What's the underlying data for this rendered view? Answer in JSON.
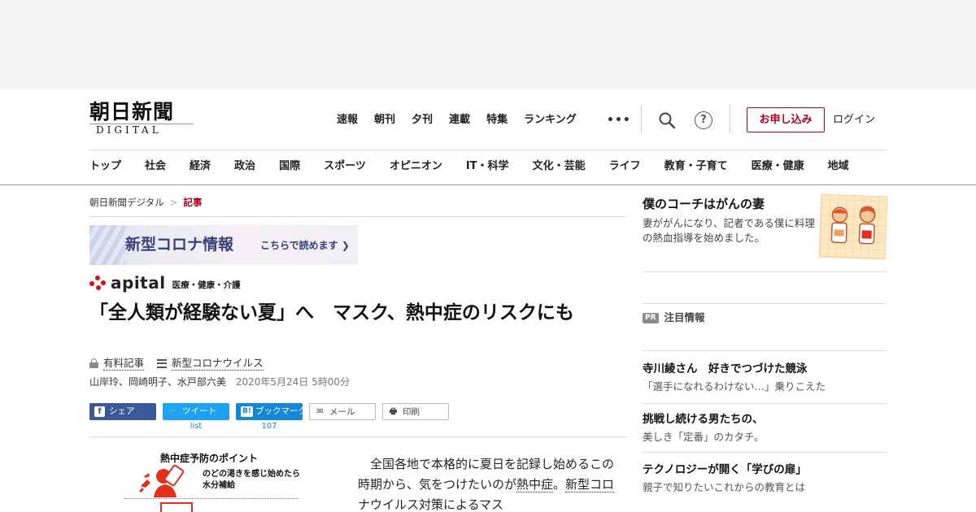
{
  "site": {
    "logo_main": "朝日新聞",
    "logo_sub": "DIGITAL"
  },
  "topnav": [
    "速報",
    "朝刊",
    "夕刊",
    "連載",
    "特集",
    "ランキング"
  ],
  "more_icon": "more-dots-icon",
  "header": {
    "help_glyph": "?",
    "apply_label": "お申し込み",
    "login_label": "ログイン"
  },
  "categories": [
    "トップ",
    "社会",
    "経済",
    "政治",
    "国際",
    "スポーツ",
    "オピニオン",
    "IT・科学",
    "文化・芸能",
    "ライフ",
    "教育・子育て",
    "医療・健康",
    "地域"
  ],
  "breadcrumb": {
    "home": "朝日新聞デジタル",
    "separator": ">",
    "current": "記事"
  },
  "corona_banner": {
    "title": "新型コロナ情報",
    "cta": "こちらで読めます ❯"
  },
  "apital": {
    "word": "apital",
    "sub": "医療・健康・介護"
  },
  "article": {
    "title": "「全人類が経験ない夏」へ　マスク、熱中症のリスクにも",
    "paid_label": "有料記事",
    "topic_label": "新型コロナウイルス",
    "authors": "山岸玲、岡崎明子、水戸部六美",
    "date": "2020年5月24日 5時00分"
  },
  "share": {
    "facebook": {
      "icon": "f",
      "label": "シェア"
    },
    "twitter": {
      "icon": "🐦",
      "label": "ツイート",
      "count": "list"
    },
    "hatena": {
      "icon": "B!",
      "label": "ブックマーク",
      "count": "107"
    },
    "mail": {
      "icon": "✉",
      "label": "メール"
    },
    "print": {
      "icon": "🖶",
      "label": "印刷"
    }
  },
  "figure": {
    "title": "熱中症予防のポイント",
    "line1": "のどの渇きを感じ始めたら",
    "line2": "水分補給"
  },
  "body": {
    "p1_a": "全国各地で本格的に夏日を記録し始めるこの時期から、気をつけたいのが",
    "p1_link1": "熱中症",
    "p1_b": "。",
    "p1_link2": "新型コロナウイルス",
    "p1_c": "対策によるマス"
  },
  "sidebar": {
    "feature": {
      "title": "僕のコーチはがんの妻",
      "desc": "妻ががんになり、記者である僕に料理の熱血指導を始めました。"
    },
    "pr_badge": "PR",
    "pr_label": "注目情報",
    "pr_items": [
      {
        "title": "寺川綾さん　好きでつづけた競泳",
        "desc": "「選手になれるわけない…」乗りこえた"
      },
      {
        "title": "挑戦し続ける男たちの、",
        "desc": "美しき「定番」のカタチ。"
      },
      {
        "title": "テクノロジーが開く「学びの扉」",
        "desc": "親子で知りたいこれからの教育とは"
      }
    ]
  },
  "colors": {
    "brand_red": "#b5001c",
    "facebook": "#3b5998",
    "twitter": "#1da1f2",
    "hatena": "#1588d5"
  }
}
